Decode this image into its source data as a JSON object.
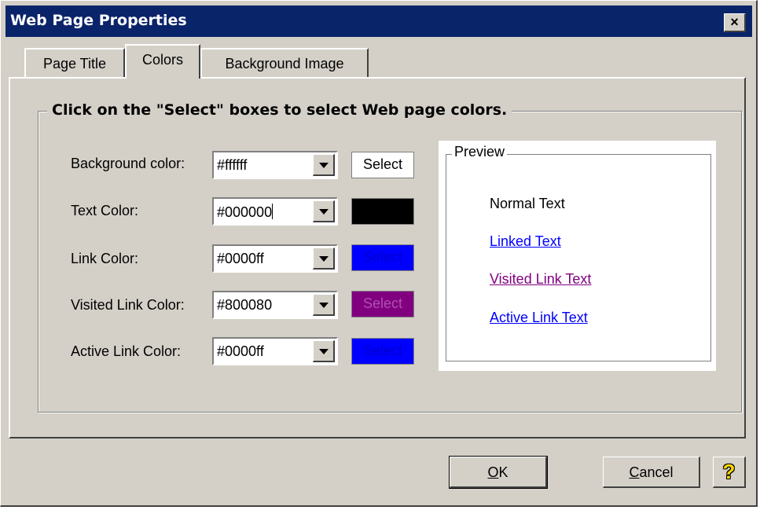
{
  "window": {
    "title": "Web Page Properties",
    "close_glyph": "×"
  },
  "tabs": [
    {
      "label": "Page Title",
      "active": false
    },
    {
      "label": "Colors",
      "active": true
    },
    {
      "label": "Background Image",
      "active": false
    }
  ],
  "group": {
    "legend": "Click on the \"Select\" boxes to select Web page colors."
  },
  "rows": [
    {
      "label": "Background color:",
      "value": "#ffffff",
      "select_label": "Select",
      "swatch_color": "#ffffff",
      "text_color": "#000000"
    },
    {
      "label": "Text Color:",
      "value": "#000000",
      "select_label": "",
      "swatch_color": "#000000",
      "text_color": "#000000"
    },
    {
      "label": "Link Color:",
      "value": "#0000ff",
      "select_label": "Select",
      "swatch_color": "#0000ff",
      "text_color": "#0000cc"
    },
    {
      "label": "Visited Link Color:",
      "value": "#800080",
      "select_label": "Select",
      "swatch_color": "#800080",
      "text_color": "#b050b0"
    },
    {
      "label": "Active Link Color:",
      "value": "#0000ff",
      "select_label": "Select",
      "swatch_color": "#0000ff",
      "text_color": "#0000cc"
    }
  ],
  "preview": {
    "legend": "Preview",
    "normal_text": "Normal Text",
    "linked_text": "Linked Text",
    "visited_text": "Visited Link Text",
    "active_text": "Active Link Text",
    "colors": {
      "normal": "#000000",
      "link": "#0000ff",
      "visited": "#800080",
      "active": "#0000ff"
    }
  },
  "buttons": {
    "ok_accel": "O",
    "ok_rest": "K",
    "cancel_accel": "C",
    "cancel_rest": "ancel",
    "help_glyph": "?"
  },
  "icons": {
    "help": "help-question-icon",
    "close": "close-icon",
    "dropdown": "chevron-down-icon"
  }
}
